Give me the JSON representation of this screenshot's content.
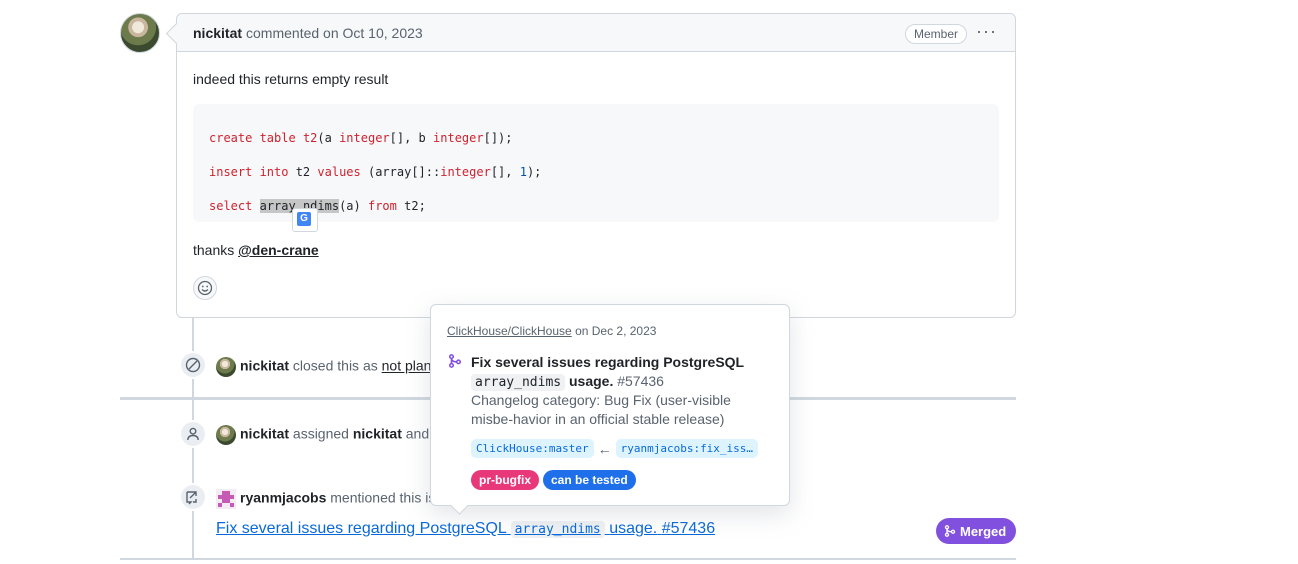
{
  "comment": {
    "author": "nickitat",
    "meta": "commented on Oct 10, 2023",
    "badge": "Member",
    "menu": "···",
    "text": "indeed this returns empty result",
    "code": {
      "line1": {
        "kw1": "create table",
        "id": "t2",
        "open": "(a ",
        "type1": "integer",
        "mid": "[], b ",
        "type2": "integer",
        "end": "[]);"
      },
      "line2": {
        "kw1": "insert into",
        "id": " t2 ",
        "kw2": "values",
        "open": " (array[]::",
        "type": "integer",
        "mid": "[], ",
        "num": "1",
        "end": ");"
      },
      "line3": {
        "kw1": "select",
        "hl": "array_ndims",
        "mid": "(a) ",
        "kw2": "from",
        "end": " t2;"
      }
    },
    "thanks_prefix": "thanks",
    "mention": "@den-crane"
  },
  "events": {
    "closed": {
      "user": "nickitat",
      "text": "closed this as",
      "link": "not planned"
    },
    "assigned": {
      "user": "nickitat",
      "text": "assigned",
      "target": "nickitat",
      "tail": "and c"
    },
    "mentioned": {
      "user": "ryanmjacobs",
      "text": "mentioned this is"
    }
  },
  "pr_link": {
    "prefix": "Fix several issues regarding PostgreSQL",
    "code": "array_ndims",
    "suffix": "usage.",
    "number": "#57436"
  },
  "merged_badge": "Merged",
  "popup": {
    "repo": "ClickHouse/ClickHouse",
    "date": "on Dec 2, 2023",
    "title_prefix": "Fix several issues regarding PostgreSQL",
    "title_code": "array_ndims",
    "title_suffix": "usage.",
    "number": "#57436",
    "description": "Changelog category: Bug Fix (user-visible misbe-havior in an official stable release)",
    "base_branch": "ClickHouse:master",
    "arrow": "←",
    "head_branch": "ryanmjacobs:fix_iss…",
    "labels": [
      {
        "name": "pr-bugfix",
        "color": "#e9387a"
      },
      {
        "name": "can be tested",
        "color": "#1f6feb"
      }
    ]
  },
  "colors": {
    "merged": "#8250df",
    "link": "#0969da",
    "border": "#d0d7de"
  }
}
